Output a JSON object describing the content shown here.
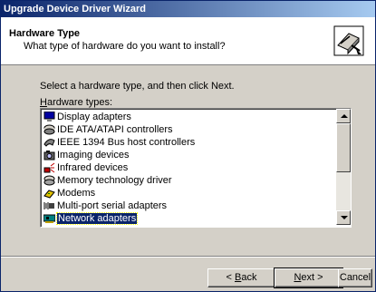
{
  "window": {
    "title": "Upgrade Device Driver Wizard"
  },
  "header": {
    "title": "Hardware Type",
    "subtitle": "What type of hardware do you want to install?",
    "icon": "hardware-wizard-icon"
  },
  "body": {
    "instruction": "Select a hardware type, and then click Next.",
    "list_label_accel": "H",
    "list_label_rest": "ardware types:"
  },
  "list": {
    "items": [
      {
        "label": "Display adapters",
        "icon": "monitor-icon"
      },
      {
        "label": "IDE ATA/ATAPI controllers",
        "icon": "disk-controller-icon"
      },
      {
        "label": "IEEE 1394 Bus host controllers",
        "icon": "bus-controller-icon"
      },
      {
        "label": "Imaging devices",
        "icon": "camera-icon"
      },
      {
        "label": "Infrared devices",
        "icon": "infrared-icon"
      },
      {
        "label": "Memory technology driver",
        "icon": "memory-icon"
      },
      {
        "label": "Modems",
        "icon": "modem-icon"
      },
      {
        "label": "Multi-port serial adapters",
        "icon": "serial-port-icon"
      },
      {
        "label": "Network adapters",
        "icon": "network-adapter-icon",
        "selected": true
      }
    ]
  },
  "buttons": {
    "back_prefix": "< ",
    "back_accel": "B",
    "back_rest": "ack",
    "next_accel": "N",
    "next_rest": "ext >",
    "cancel": "Cancel"
  },
  "colors": {
    "titlebar": "#0a246a",
    "selection": "#0a246a",
    "face": "#d4d0c8"
  }
}
